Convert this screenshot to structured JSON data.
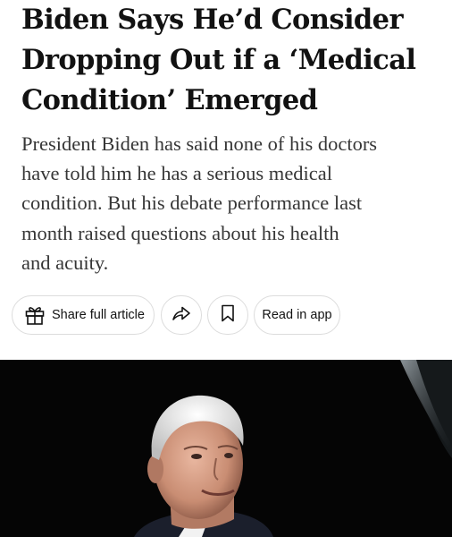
{
  "article": {
    "headline_lines": [
      "Biden Says He’d Consider",
      "Dropping Out if a ‘Medical",
      "Condition’ Emerged"
    ],
    "summary_lines": [
      "President Biden has said none of his doctors",
      "have told him he has a serious medical",
      "condition. But his debate performance last",
      "month raised questions about his health",
      "and acuity."
    ]
  },
  "share_bar": {
    "share_full_label": "Share full article",
    "read_in_app_label": "Read in app",
    "share_full_icon": "gift-icon",
    "share_icon": "share-arrow-icon",
    "save_icon": "bookmark-icon"
  },
  "colors": {
    "headline": "#121212",
    "summary": "#363636",
    "pill_border": "#dcdcdc",
    "photo_background": "#050505"
  }
}
